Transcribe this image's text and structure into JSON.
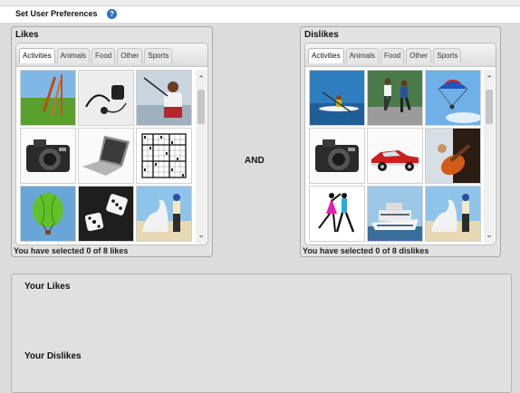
{
  "header": {
    "title": "Set User Preferences",
    "help_icon": "question-circle-icon"
  },
  "likes": {
    "title": "Likes",
    "tabs": [
      "Activities",
      "Animals",
      "Food",
      "Other",
      "Sports"
    ],
    "active_tab": "Activities",
    "images": [
      "golf-course-icon",
      "headphones-icon",
      "fishing-icon",
      "camera-icon",
      "laptop-icon",
      "sudoku-icon",
      "hot-air-balloon-icon",
      "dice-icon",
      "horse-rider-icon"
    ],
    "status": "You have selected 0 of 8 likes"
  },
  "connector": "AND",
  "dislikes": {
    "title": "Dislikes",
    "tabs": [
      "Activities",
      "Animals",
      "Food",
      "Other",
      "Sports"
    ],
    "active_tab": "Activities",
    "images": [
      "kayaking-icon",
      "running-icon",
      "parachute-icon",
      "camera-icon",
      "classic-car-icon",
      "guitar-icon",
      "dancing-couple-icon",
      "cruise-ship-icon",
      "horse-rider-icon"
    ],
    "status": "You have selected 0 of 8 dislikes"
  },
  "summary": {
    "likes_label": "Your Likes",
    "dislikes_label": "Your Dislikes"
  },
  "colors": {
    "accent": "#2d72c4",
    "panel_bg": "#e2e2e2"
  }
}
